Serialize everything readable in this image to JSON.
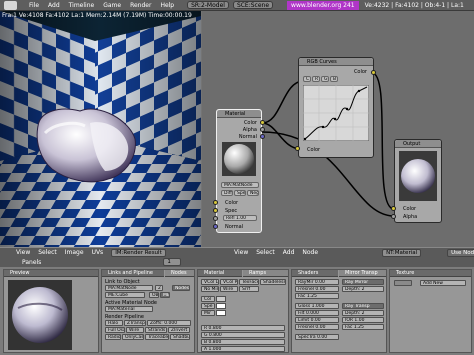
{
  "topbar": {
    "menus": [
      "File",
      "Add",
      "Timeline",
      "Game",
      "Render",
      "Help"
    ],
    "screen": "SR:2-Model",
    "scene": "SCE:Scene",
    "url": "www.blender.org 241",
    "stats": "Ve:4232 | Fa:4102 | Ob:4-1 | La:1"
  },
  "render": {
    "info": "Fra:1  Ve:4108 Fa:4102 La:1 Mem:2.14M (7.19M) Time:00:00.19"
  },
  "nodes": {
    "material": {
      "title": "Material",
      "out_color": "Color",
      "out_alpha": "Alpha",
      "out_normal": "Normal",
      "mat_name": "MA:MatNode",
      "btn_diff": "Diff",
      "btn_spec": "Spec",
      "btn_neg": "Neg",
      "in_color": "Color",
      "in_spec": "Spec",
      "in_refl": "Refl 1.00",
      "in_normal": "Normal"
    },
    "curves": {
      "title": "RGB Curves",
      "in_color": "Color",
      "out_color": "Color",
      "channels": [
        "C",
        "R",
        "G",
        "B"
      ]
    },
    "output": {
      "title": "Output",
      "in_color": "Color",
      "in_alpha": "Alpha"
    }
  },
  "render_header": {
    "menus": [
      "View",
      "Select",
      "Image",
      "UVs"
    ],
    "image_name": "IM:Render Result"
  },
  "node_header": {
    "menus": [
      "View",
      "Select",
      "Add",
      "Node"
    ],
    "material_name": "NT:Material",
    "use_nodes": "Use Nodes"
  },
  "buttons_header": {
    "label": "Panels",
    "frame": "1"
  },
  "panels": {
    "preview": {
      "title": "Preview"
    },
    "links": {
      "title": "Links and Pipeline",
      "tab2": "Nodes",
      "link_to_object": "Link to Object",
      "mat_name": "MA:MatNode",
      "mat_users": "2",
      "ob_me": "ME:Cube",
      "ob_me_buttons": [
        "OB",
        "ME"
      ],
      "active_material": "Active Material Node",
      "node_mat": "MA:Material",
      "render_pipeline": "Render Pipeline",
      "pipeline_buttons": [
        "Halo",
        "ZTransp",
        "Zoffs: 0.000",
        "Full Osa",
        "Wire",
        "Strands",
        "ZInvert",
        "Radio",
        "OnlyCast",
        "Traceable",
        "Shadbuf"
      ]
    },
    "material": {
      "title": "Material",
      "tab2": "Ramps",
      "buttons": [
        "VCol Light",
        "VCol Paint",
        "TexFace",
        "Shadeless",
        "No Mir",
        "Wire",
        "Srrf"
      ],
      "sliders": [
        "R 0.800",
        "G 0.800",
        "B 0.800",
        "A 1.000"
      ],
      "rows": [
        "Col",
        "Spe",
        "Mir"
      ]
    },
    "shaders": {
      "title": "Shaders",
      "tab2": "Mirror Transp",
      "rows": [
        "RayMir 0.00",
        "Fresnel 0.00",
        "Fac 1.25",
        "Gloss 1.000",
        "Filt 0.000",
        "Limit 0.00",
        "Fresnel 0.00",
        "SpecTra 0.00"
      ],
      "buttons": [
        "Ray Mirror",
        "Depth: 2",
        "Ray Transp",
        "Depth: 2",
        "IOR 1.00",
        "Fac 1.25"
      ]
    },
    "texture": {
      "title": "Texture",
      "add_new": "Add New"
    }
  }
}
